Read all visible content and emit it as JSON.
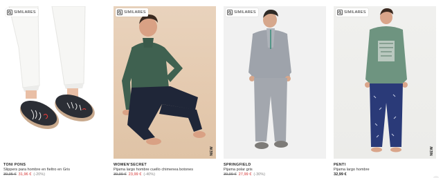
{
  "badge_label": "SIMILARES",
  "products": [
    {
      "brand": "TONI PONS",
      "title": "Slippers para hombre en fieltro en Gris",
      "old_price": "39,95 €",
      "price": "31,96 €",
      "discount": "(-20%)",
      "new_label": ""
    },
    {
      "brand": "WOMEN'SECRET",
      "title": "Pijama largo hombre cuello chimenea botones",
      "old_price": "39,99 €",
      "price": "23,99 €",
      "discount": "(-40%)",
      "new_label": "NEW"
    },
    {
      "brand": "SPRINGFIELD",
      "title": "Pijama polar gris",
      "old_price": "39,99 €",
      "price": "27,99 €",
      "discount": "(-30%)",
      "new_label": ""
    },
    {
      "brand": "PENTI",
      "title": "Pijama largo hombre",
      "old_price": "",
      "price": "32,99 €",
      "discount": "",
      "new_label": "NEW"
    }
  ],
  "colors": {
    "sale": "#d32d2d",
    "strike": "#666666",
    "discount": "#888888"
  }
}
